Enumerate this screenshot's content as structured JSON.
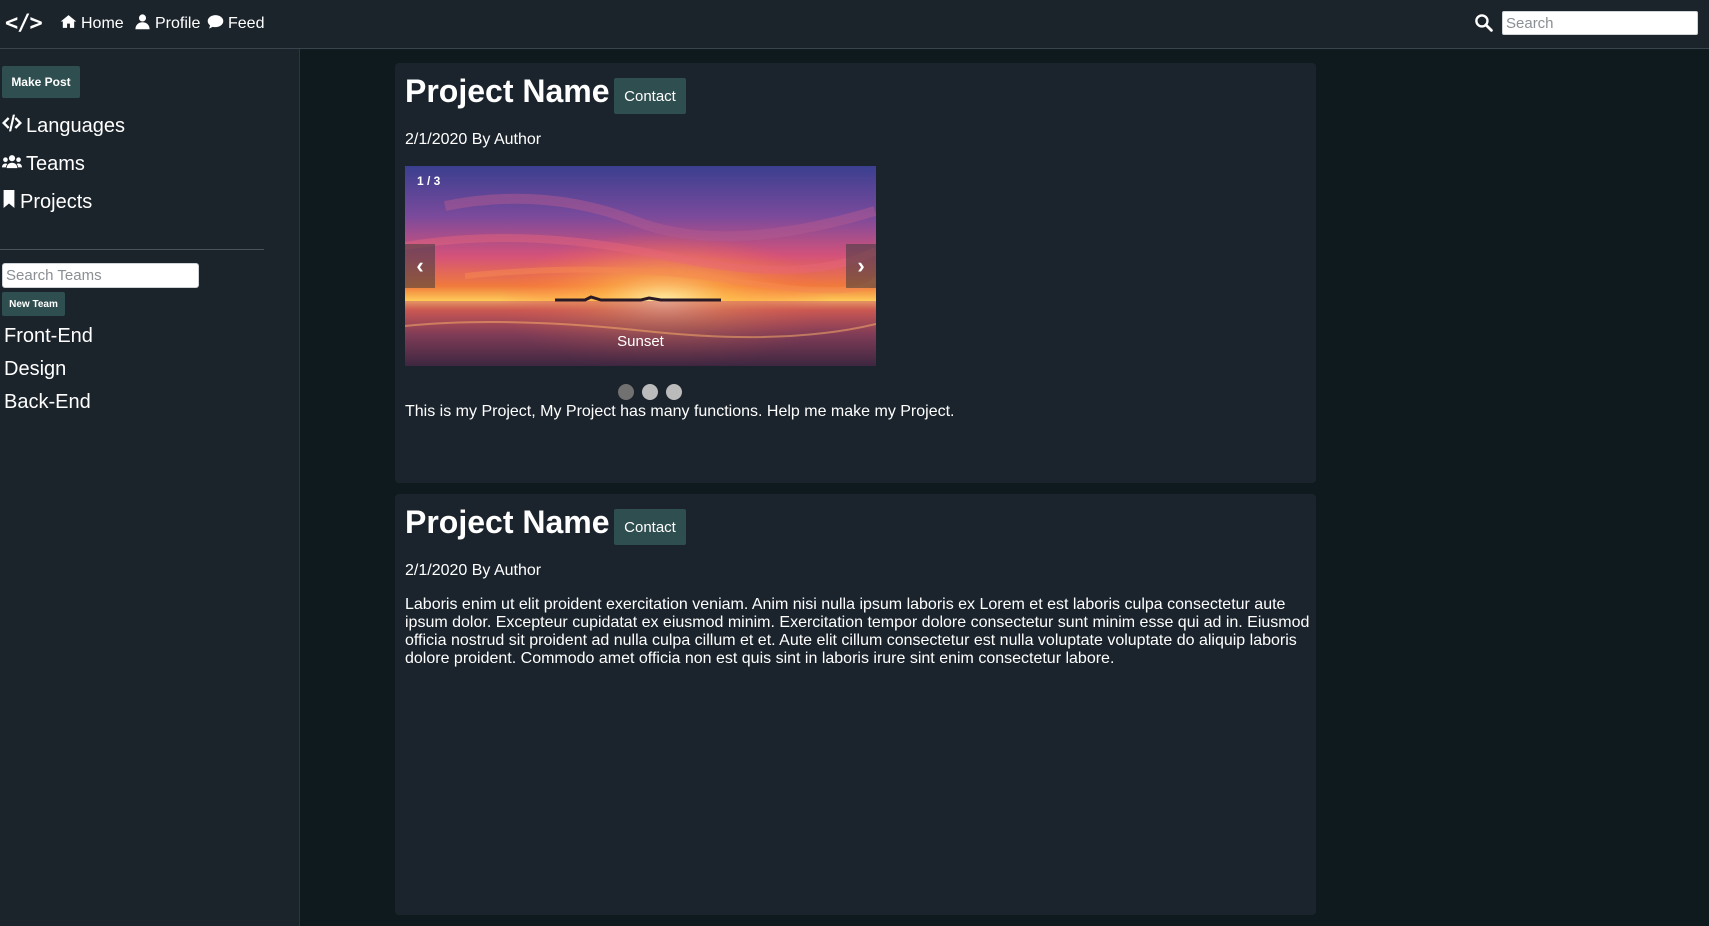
{
  "navbar": {
    "brand": "</>",
    "links": [
      {
        "label": "Home",
        "icon": "home-icon"
      },
      {
        "label": "Profile",
        "icon": "user-icon"
      },
      {
        "label": "Feed",
        "icon": "comment-icon"
      }
    ],
    "search": {
      "placeholder": "Search",
      "value": ""
    }
  },
  "sidebar": {
    "make_post_label": "Make Post",
    "links": [
      {
        "label": "Languages",
        "icon": "code-icon"
      },
      {
        "label": "Teams",
        "icon": "users-icon"
      },
      {
        "label": "Projects",
        "icon": "bookmark-icon"
      }
    ],
    "team_search": {
      "placeholder": "Search Teams",
      "value": ""
    },
    "new_team_label": "New Team",
    "teams": [
      "Front-End",
      "Design",
      "Back-End"
    ]
  },
  "posts": [
    {
      "title": "Project Name",
      "contact_label": "Contact",
      "meta": "2/1/2020 By Author",
      "carousel": {
        "counter": "1 / 3",
        "caption": "Sunset",
        "prev_symbol": "‹",
        "next_symbol": "›",
        "slide_count": 3,
        "active_index": 0
      },
      "body": "This is my Project, My Project has many functions. Help me make my Project."
    },
    {
      "title": "Project Name",
      "contact_label": "Contact",
      "meta": "2/1/2020 By Author",
      "body": "Laboris enim ut elit proident exercitation veniam. Anim nisi nulla ipsum laboris ex Lorem et est laboris culpa consectetur aute ipsum dolor. Excepteur cupidatat ex eiusmod minim. Exercitation tempor dolore consectetur sunt minim esse qui ad in. Eiusmod officia nostrud sit proident ad nulla culpa cillum et et. Aute elit cillum consectetur est nulla voluptate voluptate do aliquip laboris dolore proident. Commodo amet officia non est quis sint in laboris irure sint enim consectetur labore."
    }
  ],
  "colors": {
    "page_bg": "#0f1a1f",
    "panel_bg": "#1b232b",
    "button_bg": "#2f4e4f",
    "text": "#ffffff"
  }
}
